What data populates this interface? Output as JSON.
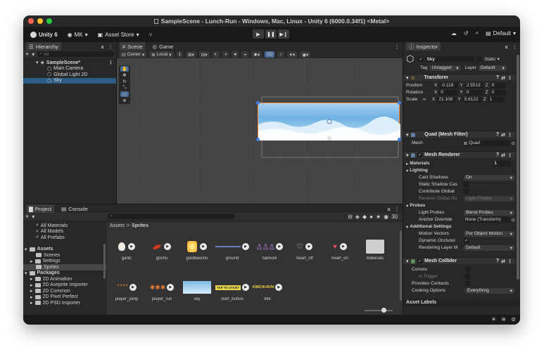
{
  "window": {
    "title": "SampleScene - Lunch-Run - Windows, Mac, Linux - Unity 6 (6000.0.34f1) <Metal>"
  },
  "toolbar": {
    "unity_label": "Unity 6",
    "account_label": "MK",
    "asset_store_label": "Asset Store",
    "layout_label": "Default"
  },
  "hierarchy": {
    "tab_label": "Hierarchy",
    "search_placeholder": "All",
    "rows": [
      {
        "label": "SampleScene*"
      },
      {
        "label": "Main Camera"
      },
      {
        "label": "Global Light 2D"
      },
      {
        "label": "Sky"
      }
    ]
  },
  "scene": {
    "tab_scene": "Scene",
    "tab_game": "Game",
    "center_label": "Center",
    "local_label": "Local",
    "grid_value": "1",
    "mode_2d": "2D"
  },
  "inspector": {
    "tab_label": "Inspector",
    "object_name": "Sky",
    "static_label": "Static",
    "tag_label": "Tag",
    "tag_value": "Untagged",
    "layer_label": "Layer",
    "layer_value": "Default",
    "transform": {
      "title": "Transform",
      "position_label": "Position",
      "rotation_label": "Rotation",
      "scale_label": "Scale",
      "pos_x": "-0.118",
      "pos_y": "2.5513",
      "pos_z": "0",
      "rot_x": "0",
      "rot_y": "0",
      "rot_z": "0",
      "scale_x": "21.108",
      "scale_y": "5.6122",
      "scale_z": "1"
    },
    "mesh_filter": {
      "title": "Quad (Mesh Filter)",
      "mesh_label": "Mesh",
      "mesh_value": "Quad"
    },
    "mesh_renderer": {
      "title": "Mesh Renderer",
      "materials_label": "Materials",
      "materials_count": "1",
      "lighting_label": "Lighting",
      "cast_shadows_label": "Cast Shadows",
      "cast_shadows_value": "On",
      "static_shadow_label": "Static Shadow Cas",
      "contribute_gi_label": "Contribute Global",
      "receive_gi_label": "Receive Global Illu",
      "receive_gi_value": "Light Probes",
      "probes_label": "Probes",
      "light_probes_label": "Light Probes",
      "light_probes_value": "Blend Probes",
      "anchor_label": "Anchor Override",
      "anchor_value": "None (Transform)",
      "additional_label": "Additional Settings",
      "motion_vectors_label": "Motion Vectors",
      "motion_vectors_value": "Per Object Motion",
      "dynamic_occlusion_label": "Dynamic Occlusio",
      "rendering_layer_label": "Rendering Layer M",
      "rendering_layer_value": "Default"
    },
    "mesh_collider": {
      "title": "Mesh Collider",
      "convex_label": "Convex",
      "is_trigger_label": "Is Trigger",
      "provides_contacts_label": "Provides Contacts",
      "cooking_label": "Cooking Options",
      "cooking_value": "Everything"
    },
    "asset_labels": "Asset Labels"
  },
  "project": {
    "tab_project": "Project",
    "tab_console": "Console",
    "breadcrumb_root": "Assets",
    "breadcrumb_sep": ">",
    "breadcrumb_current": "Sprites",
    "visibility_count": "30",
    "tree": [
      {
        "label": "All Materials"
      },
      {
        "label": "All Models"
      },
      {
        "label": "All Prefabs"
      },
      {
        "label": "Assets"
      },
      {
        "label": "Scenes"
      },
      {
        "label": "Settings"
      },
      {
        "label": "Sprites"
      },
      {
        "label": "Packages"
      },
      {
        "label": "2D Animation"
      },
      {
        "label": "2D Aseprite Importer"
      },
      {
        "label": "2D Common"
      },
      {
        "label": "2D Pixel Perfect"
      },
      {
        "label": "2D PSD Importer"
      }
    ],
    "assets_row1": [
      {
        "label": "garlic"
      },
      {
        "label": "gochu"
      },
      {
        "label": "goldbaechu"
      },
      {
        "label": "ground"
      },
      {
        "label": "halmoni"
      },
      {
        "label": "heart_off"
      },
      {
        "label": "heart_on"
      },
      {
        "label": "Materials"
      }
    ],
    "assets_row2": [
      {
        "label": "player_jump"
      },
      {
        "label": "player_run"
      },
      {
        "label": "sky"
      },
      {
        "label": "start_button"
      },
      {
        "label": "title"
      }
    ],
    "start_button_text": "TAP TO START",
    "title_text": "KIMCHI-RUN"
  },
  "colors": {
    "accent": "#2c5d87",
    "selection": "#4a6b95"
  }
}
